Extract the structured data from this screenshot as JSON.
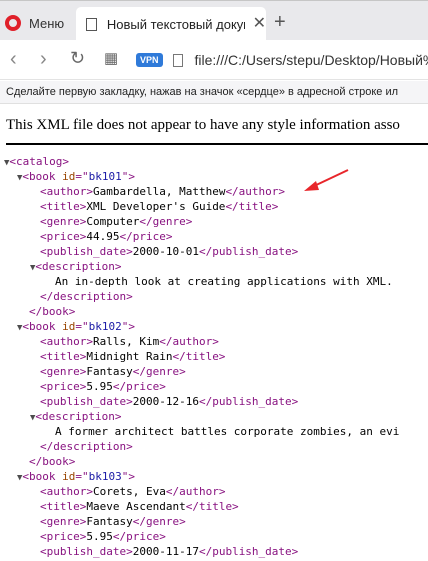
{
  "tabs": {
    "menu_label": "Меню",
    "active_title": "Новый текстовый докуме"
  },
  "toolbar": {
    "vpn_label": "VPN",
    "url": "file:///C:/Users/stepu/Desktop/Новый%"
  },
  "bookmark_hint": "Сделайте первую закладку, нажав на значок «сердце» в адресной строке ил",
  "xml_note": "This XML file does not appear to have any style information asso",
  "xml": {
    "root_open": "<catalog>",
    "books": [
      {
        "id": "bk101",
        "author": "Gambardella, Matthew",
        "title": "XML Developer's Guide",
        "genre": "Computer",
        "price": "44.95",
        "publish_date": "2000-10-01",
        "description": "An in-depth look at creating applications with XML."
      },
      {
        "id": "bk102",
        "author": "Ralls, Kim",
        "title": "Midnight Rain",
        "genre": "Fantasy",
        "price": "5.95",
        "publish_date": "2000-12-16",
        "description": "A former architect battles corporate zombies, an evi"
      },
      {
        "id": "bk103",
        "author": "Corets, Eva",
        "title": "Maeve Ascendant",
        "genre": "Fantasy",
        "price": "5.95",
        "publish_date": "2000-11-17"
      }
    ]
  },
  "colors": {
    "tag": "#881280",
    "attr_name": "#994500",
    "attr_value": "#1a1aa6",
    "annotation_arrow": "#e8262b",
    "opera_red": "#e0202a",
    "vpn_blue": "#2f7ad9"
  }
}
